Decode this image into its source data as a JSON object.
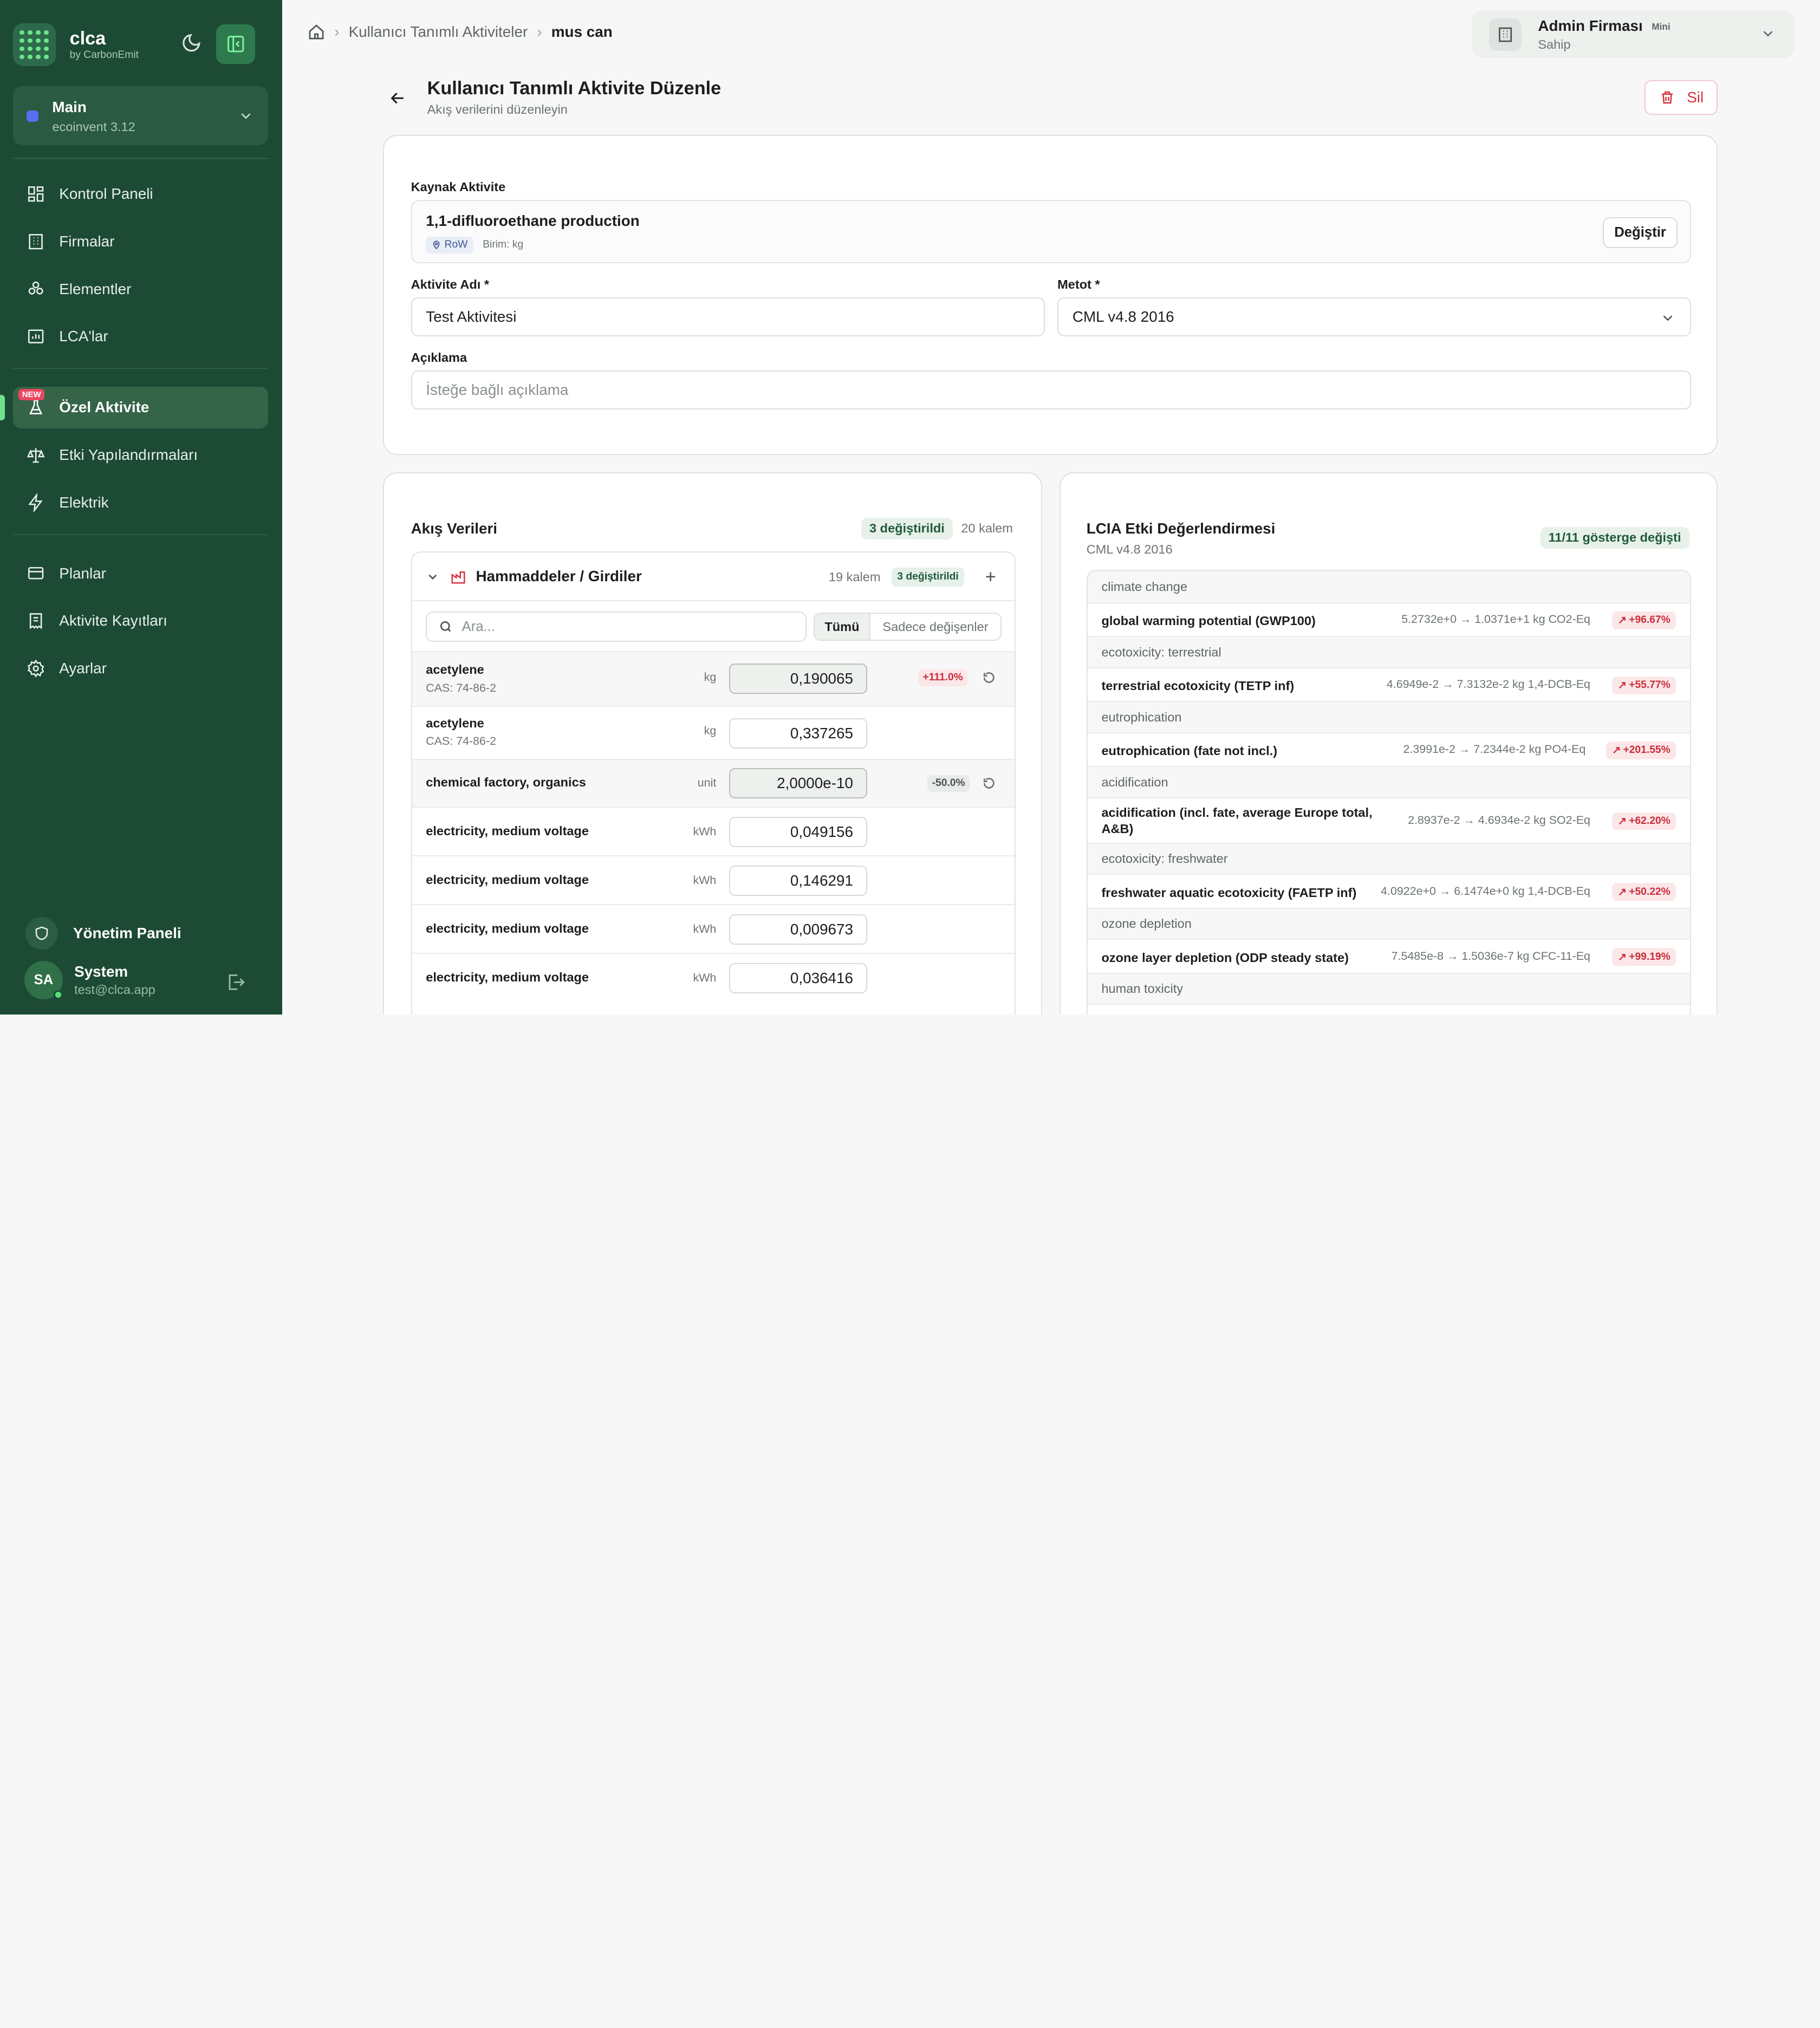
{
  "brand": {
    "name": "clca",
    "tagline": "by CarbonEmit"
  },
  "workspace": {
    "name": "Main",
    "version": "ecoinvent 3.12"
  },
  "nav": [
    {
      "label": "Kontrol Paneli",
      "icon": "dashboard-icon"
    },
    {
      "label": "Firmalar",
      "icon": "building-icon"
    },
    {
      "label": "Elementler",
      "icon": "elements-icon"
    },
    {
      "label": "LCA'lar",
      "icon": "chart-icon"
    },
    {
      "label": "Özel Aktivite",
      "icon": "flask-icon",
      "badge": "NEW",
      "active": true
    },
    {
      "label": "Etki Yapılandırmaları",
      "icon": "scale-icon"
    },
    {
      "label": "Elektrik",
      "icon": "bolt-icon"
    },
    {
      "label": "Planlar",
      "icon": "card-icon"
    },
    {
      "label": "Aktivite Kayıtları",
      "icon": "receipt-icon"
    },
    {
      "label": "Ayarlar",
      "icon": "gear-icon"
    }
  ],
  "admin_panel": "Yönetim Paneli",
  "user": {
    "initials": "SA",
    "name": "System",
    "email": "test@clca.app"
  },
  "breadcrumb": {
    "parent": "Kullanıcı Tanımlı Aktiviteler",
    "current": "mus can"
  },
  "org": {
    "name": "Admin Firması",
    "plan": "Mini",
    "role": "Sahip"
  },
  "page": {
    "title": "Kullanıcı Tanımlı Aktivite Düzenle",
    "subtitle": "Akış verilerini düzenleyin",
    "delete_label": "Sil"
  },
  "form": {
    "source_label": "Kaynak Aktivite",
    "source_name": "1,1-difluoroethane production",
    "source_location": "RoW",
    "source_unit": "Birim: kg",
    "change_label": "Değiştir",
    "name_label": "Aktivite Adı *",
    "name_value": "Test Aktivitesi",
    "method_label": "Metot *",
    "method_value": "CML v4.8 2016",
    "desc_label": "Açıklama",
    "desc_placeholder": "İsteğe bağlı açıklama"
  },
  "flows": {
    "title": "Akış Verileri",
    "changed_pill": "3 değiştirildi",
    "total": "20 kalem",
    "group": {
      "name": "Hammaddeler / Girdiler",
      "count": "19 kalem",
      "changed": "3 değiştirildi"
    },
    "search_placeholder": "Ara...",
    "filter_all": "Tümü",
    "filter_changed": "Sadece değişenler",
    "rows": [
      {
        "name": "acetylene",
        "cas": "CAS: 74-86-2",
        "unit": "kg",
        "value": "0,190065",
        "delta": "+111.0%",
        "dir": "up",
        "modified": true
      },
      {
        "name": "acetylene",
        "cas": "CAS: 74-86-2",
        "unit": "kg",
        "value": "0,337265",
        "delta": "",
        "dir": "",
        "modified": false
      },
      {
        "name": "chemical factory, organics",
        "cas": "",
        "unit": "unit",
        "value": "2,0000e-10",
        "delta": "-50.0%",
        "dir": "down",
        "modified": true
      },
      {
        "name": "electricity, medium voltage",
        "cas": "",
        "unit": "kWh",
        "value": "0,049156",
        "delta": "",
        "dir": "",
        "modified": false
      },
      {
        "name": "electricity, medium voltage",
        "cas": "",
        "unit": "kWh",
        "value": "0,146291",
        "delta": "",
        "dir": "",
        "modified": false
      },
      {
        "name": "electricity, medium voltage",
        "cas": "",
        "unit": "kWh",
        "value": "0,009673",
        "delta": "",
        "dir": "",
        "modified": false
      },
      {
        "name": "electricity, medium voltage",
        "cas": "",
        "unit": "kWh",
        "value": "0,036416",
        "delta": "",
        "dir": "",
        "modified": false
      }
    ]
  },
  "lcia": {
    "title": "LCIA Etki Değerlendirmesi",
    "method": "CML v4.8 2016",
    "changed_pill": "11/11 gösterge değişti",
    "items": [
      {
        "category": "climate change",
        "name": "global warming potential (GWP100)",
        "values": "5.2732e+0 → 1.0371e+1 kg CO2-Eq",
        "delta": "+96.67%"
      },
      {
        "category": "ecotoxicity: terrestrial",
        "name": "terrestrial ecotoxicity (TETP inf)",
        "values": "4.6949e-2 → 7.3132e-2 kg 1,4-DCB-Eq",
        "delta": "+55.77%"
      },
      {
        "category": "eutrophication",
        "name": "eutrophication (fate not incl.)",
        "values": "2.3991e-2 → 7.2344e-2 kg PO4-Eq",
        "delta": "+201.55%"
      },
      {
        "category": "acidification",
        "name": "acidification (incl. fate, average Europe total, A&B)",
        "values": "2.8937e-2 → 4.6934e-2 kg SO2-Eq",
        "delta": "+62.20%"
      },
      {
        "category": "ecotoxicity: freshwater",
        "name": "freshwater aquatic ecotoxicity (FAETP inf)",
        "values": "4.0922e+0 → 6.1474e+0 kg 1,4-DCB-Eq",
        "delta": "+50.22%"
      },
      {
        "category": "ozone depletion",
        "name": "ozone layer depletion (ODP steady state)",
        "values": "7.5485e-8 → 1.5036e-7 kg CFC-11-Eq",
        "delta": "+99.19%"
      },
      {
        "category": "human toxicity",
        "name": "",
        "values": "",
        "delta": ""
      }
    ]
  }
}
